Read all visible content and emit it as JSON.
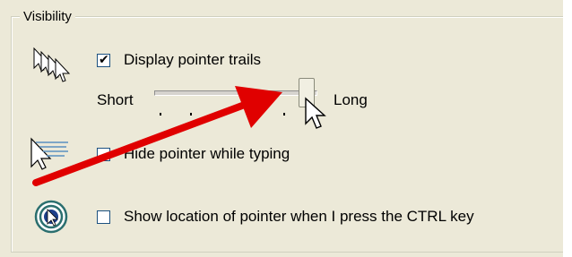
{
  "group": {
    "title": "Visibility"
  },
  "pointer_trails": {
    "label": "Display pointer trails",
    "checked": true
  },
  "trail_length": {
    "min_label": "Short",
    "max_label": "Long",
    "value_fraction": 0.95
  },
  "hide_pointer": {
    "label": "Hide pointer while typing",
    "checked": false
  },
  "show_location": {
    "label": "Show location of pointer when I press the CTRL key",
    "checked": false
  },
  "icons": {
    "trails": "pointer-trails-icon",
    "hide": "hide-pointer-icon",
    "location": "pointer-location-icon",
    "cursor": "arrow-cursor-icon",
    "annotation": "red-arrow-annotation"
  },
  "colors": {
    "panel": "#ece9d8",
    "arrow": "#e00000",
    "focus_ring": "#2b6f6f"
  }
}
